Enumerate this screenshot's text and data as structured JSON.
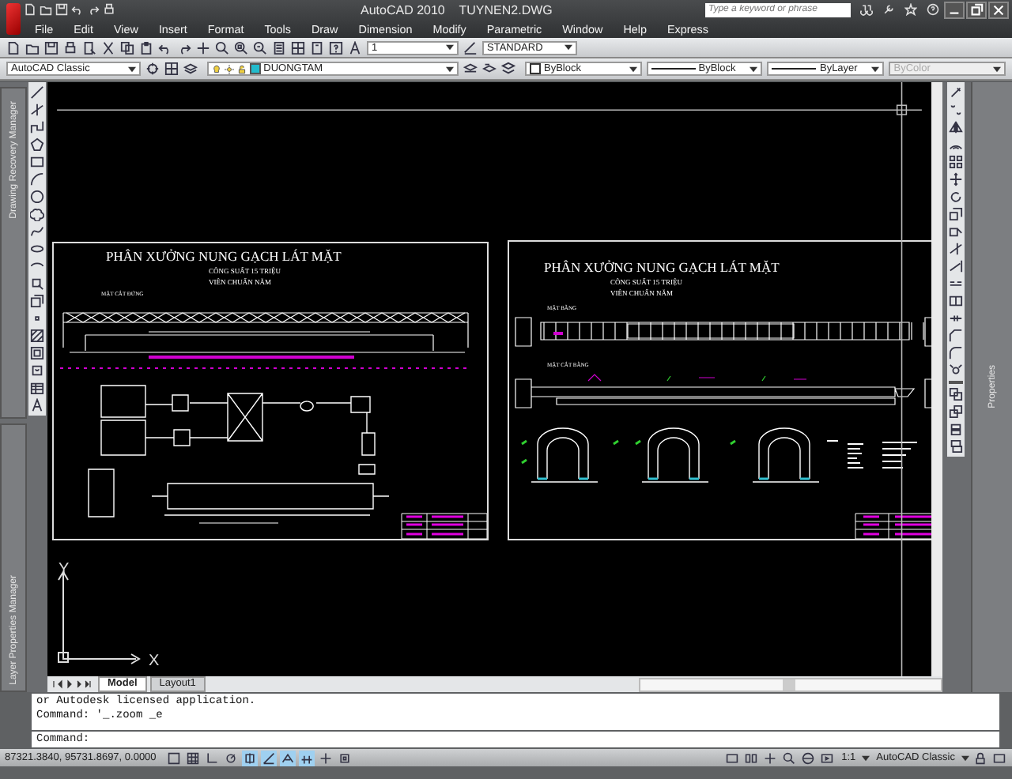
{
  "window": {
    "title": "AutoCAD 2010",
    "file": "TUYNEN2.DWG"
  },
  "search": {
    "placeholder": "Type a keyword or phrase"
  },
  "menu": [
    "File",
    "Edit",
    "View",
    "Insert",
    "Format",
    "Tools",
    "Draw",
    "Dimension",
    "Modify",
    "Parametric",
    "Window",
    "Help",
    "Express"
  ],
  "styles_toolbar": {
    "dim_scale": "1",
    "text_style": "STANDARD"
  },
  "workspace_combo": "AutoCAD Classic",
  "layer_combo": "DUONGTAM",
  "property_combos": [
    {
      "label": "ByBlock",
      "kind": "color",
      "disabled": false
    },
    {
      "label": "ByBlock",
      "kind": "linetype",
      "disabled": false
    },
    {
      "label": "ByLayer",
      "kind": "lineweight",
      "disabled": false
    },
    {
      "label": "ByColor",
      "kind": "plotstyle",
      "disabled": true
    }
  ],
  "palettes": [
    "Drawing Recovery Manager",
    "Layer Properties Manager"
  ],
  "right_palette": "Properties",
  "sheets": [
    {
      "kind": "elevation",
      "title": "PHÂN XƯỞNG NUNG GẠCH LÁT MẶT",
      "subtitle": "CÔNG SUẤT 15 TRIỆU",
      "subtitle_2": "VIÊN CHUẨN NĂM",
      "views": [
        "MẶT CẮT ĐỨNG"
      ]
    },
    {
      "kind": "plan",
      "title": "PHÂN XƯỞNG NUNG GẠCH LÁT MẶT",
      "subtitle": "CÔNG SUẤT 15 TRIỆU",
      "subtitle_2": "VIÊN CHUẨN NĂM",
      "views": [
        "MẶT BẰNG",
        "MẶT CẮT BẰNG"
      ]
    }
  ],
  "ucs": {
    "y": "Y",
    "x": "X"
  },
  "layout_tabs": [
    {
      "label": "Model",
      "selected": true
    },
    {
      "label": "Layout1",
      "selected": false
    }
  ],
  "command_history": [
    "or Autodesk licensed application.",
    "Command: '_.zoom _e"
  ],
  "command_prompt": "Command:",
  "status_bar": {
    "coordinates": "87321.3840, 95731.8697, 0.0000",
    "toggles": [
      {
        "on": false
      },
      {
        "on": false
      },
      {
        "on": false
      },
      {
        "on": false
      },
      {
        "on": true
      },
      {
        "on": true
      },
      {
        "on": true
      },
      {
        "on": true
      },
      {
        "on": false
      },
      {
        "on": false
      }
    ],
    "annotation_scale": "1:1",
    "workspace": "AutoCAD Classic"
  }
}
